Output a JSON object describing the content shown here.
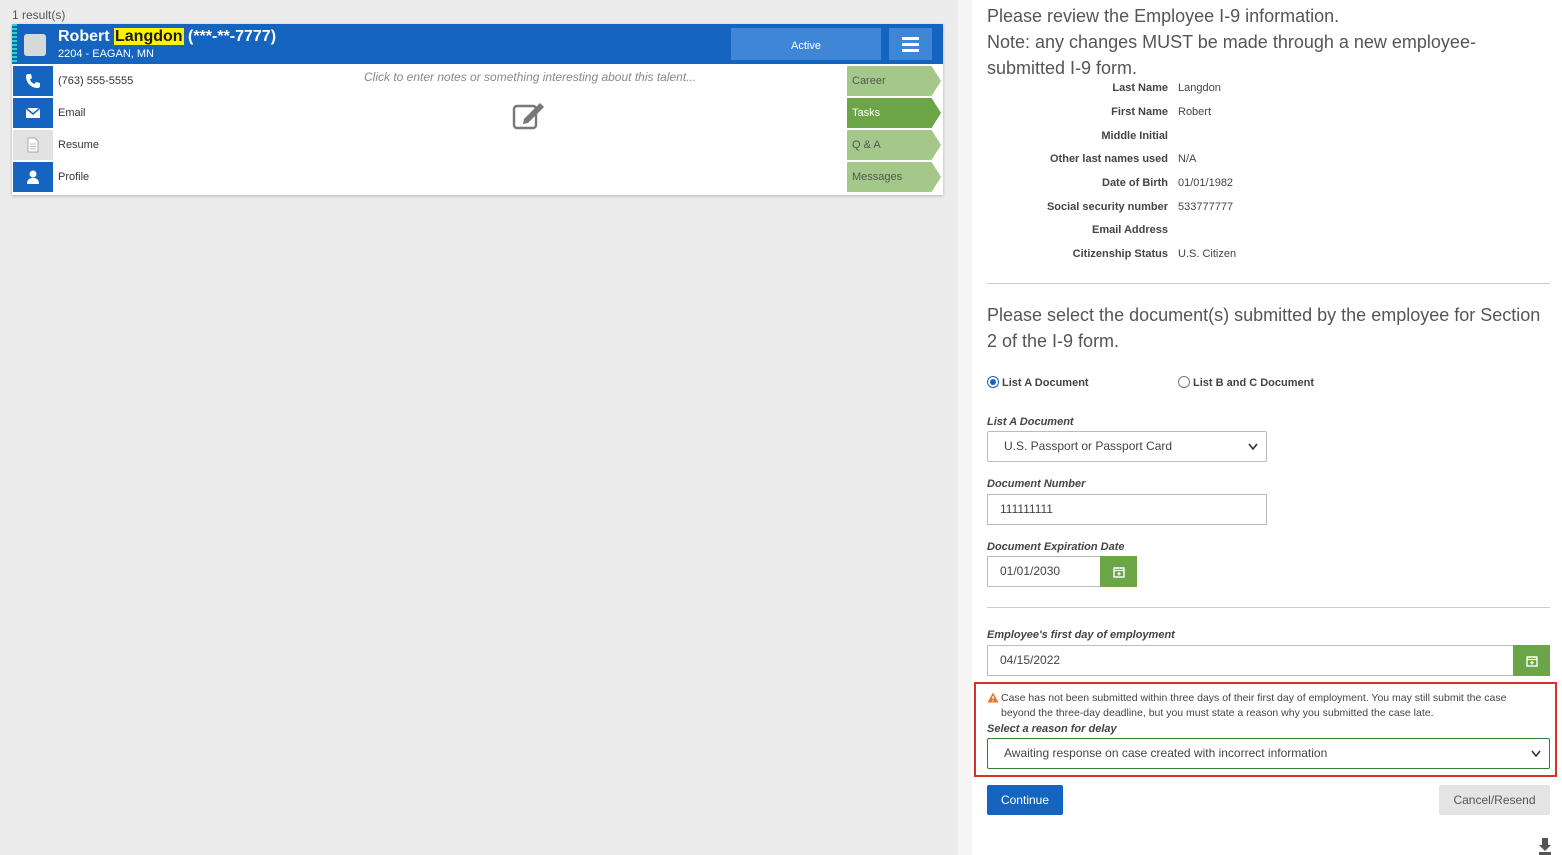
{
  "results_count": "1 result(s)",
  "talent": {
    "name_prefix": "Robert ",
    "name_highlight": "Langdon",
    "name_suffix": " (***-**-7777)",
    "subtitle": "2204 - EAGAN, MN",
    "status": "Active",
    "phone": "(763) 555-5555",
    "email_label": "Email",
    "resume_label": "Resume",
    "profile_label": "Profile",
    "notes_placeholder": "Click to enter notes or something interesting about this talent...",
    "tabs": [
      "Career",
      "Tasks",
      "Q & A",
      "Messages"
    ]
  },
  "review": {
    "heading_line1": "Please review the Employee I-9 information.",
    "heading_line2": "Note: any changes MUST be made through a new employee-",
    "heading_line3": "submitted I-9 form.",
    "fields": [
      {
        "label": "Last Name",
        "value": "Langdon"
      },
      {
        "label": "First Name",
        "value": "Robert"
      },
      {
        "label": "Middle Initial",
        "value": ""
      },
      {
        "label": "Other last names used",
        "value": "N/A"
      },
      {
        "label": "Date of Birth",
        "value": "01/01/1982"
      },
      {
        "label": "Social security number",
        "value": "533777777"
      },
      {
        "label": "Email Address",
        "value": ""
      },
      {
        "label": "Citizenship Status",
        "value": "U.S. Citizen"
      }
    ]
  },
  "documents": {
    "heading_line1": "Please select the document(s) submitted by the employee for Section",
    "heading_line2": "2 of the I-9 form.",
    "radio_a": "List A Document",
    "radio_bc": "List B and C Document",
    "list_a_label": "List A Document",
    "list_a_value": "U.S. Passport or Passport Card",
    "doc_number_label": "Document Number",
    "doc_number_value": "111111111",
    "doc_exp_label": "Document Expiration Date",
    "doc_exp_value": "01/01/2030",
    "first_day_label": "Employee's first day of employment",
    "first_day_value": "04/15/2022"
  },
  "warning": {
    "line1": "Case has not been submitted within three days of their first day of employment. You may still submit the case",
    "line2": "beyond the three-day deadline, but you must state a reason why you submitted the case late.",
    "reason_label": "Select a reason for delay",
    "reason_value": "Awaiting response on case created with incorrect information"
  },
  "buttons": {
    "continue": "Continue",
    "cancel": "Cancel/Resend"
  },
  "colors": {
    "brand_blue": "#1565c0",
    "tab_green": "#6ba547",
    "tab_light_green": "#a3c88a",
    "warning_red": "#d9302c",
    "highlight_yellow": "#fff200"
  }
}
